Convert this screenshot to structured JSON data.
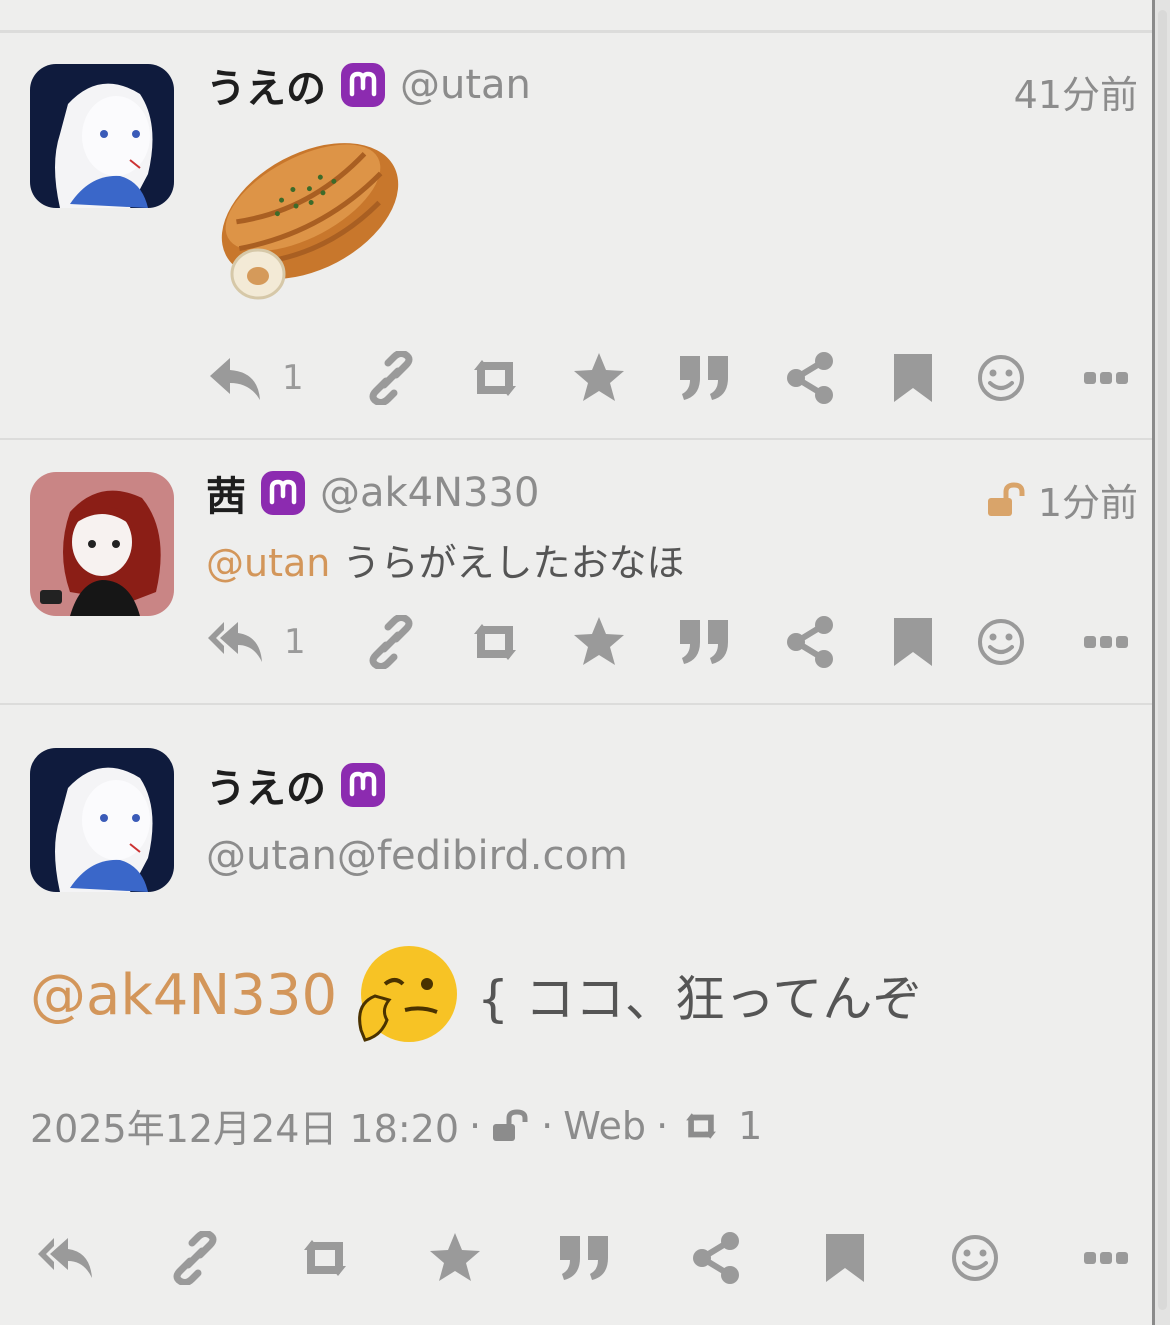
{
  "statuses": [
    {
      "display_name": "うえの",
      "acct": "@utan",
      "time": "41分前",
      "image_alt": "bread",
      "reply_count": "1",
      "icons": [
        "reply-icon",
        "link-icon",
        "boost-icon",
        "star-icon",
        "quote-icon",
        "share-icon",
        "bookmark-icon",
        "emoji-icon",
        "more-icon"
      ]
    },
    {
      "display_name": "茜",
      "acct": "@ak4N330",
      "time": "1分前",
      "visibility": "unlisted",
      "mention": "@utan",
      "text": "うらがえしたおなほ",
      "reply_count": "1",
      "icons": [
        "reply-all-icon",
        "link-icon",
        "boost-icon",
        "star-icon",
        "quote-icon",
        "share-icon",
        "bookmark-icon",
        "emoji-icon",
        "more-icon"
      ]
    }
  ],
  "detail": {
    "display_name": "うえの",
    "acct": "@utan@fedibird.com",
    "mention": "@ak4N330",
    "emoji_name": "thinking-face-emoji",
    "text": "{ ココ、狂ってんぞ",
    "datetime": "2025年12月24日 18:20",
    "dot": "·",
    "app": "Web",
    "boost_count": "1",
    "icons": [
      "reply-all-icon",
      "link-icon",
      "boost-icon",
      "star-icon",
      "quote-icon",
      "share-icon",
      "bookmark-icon",
      "emoji-icon",
      "more-icon"
    ]
  },
  "colors": {
    "mention": "#d3965a",
    "icon": "#9a9a9a",
    "mastodon": "#8c2bb0",
    "lock": "#d9a46a"
  }
}
